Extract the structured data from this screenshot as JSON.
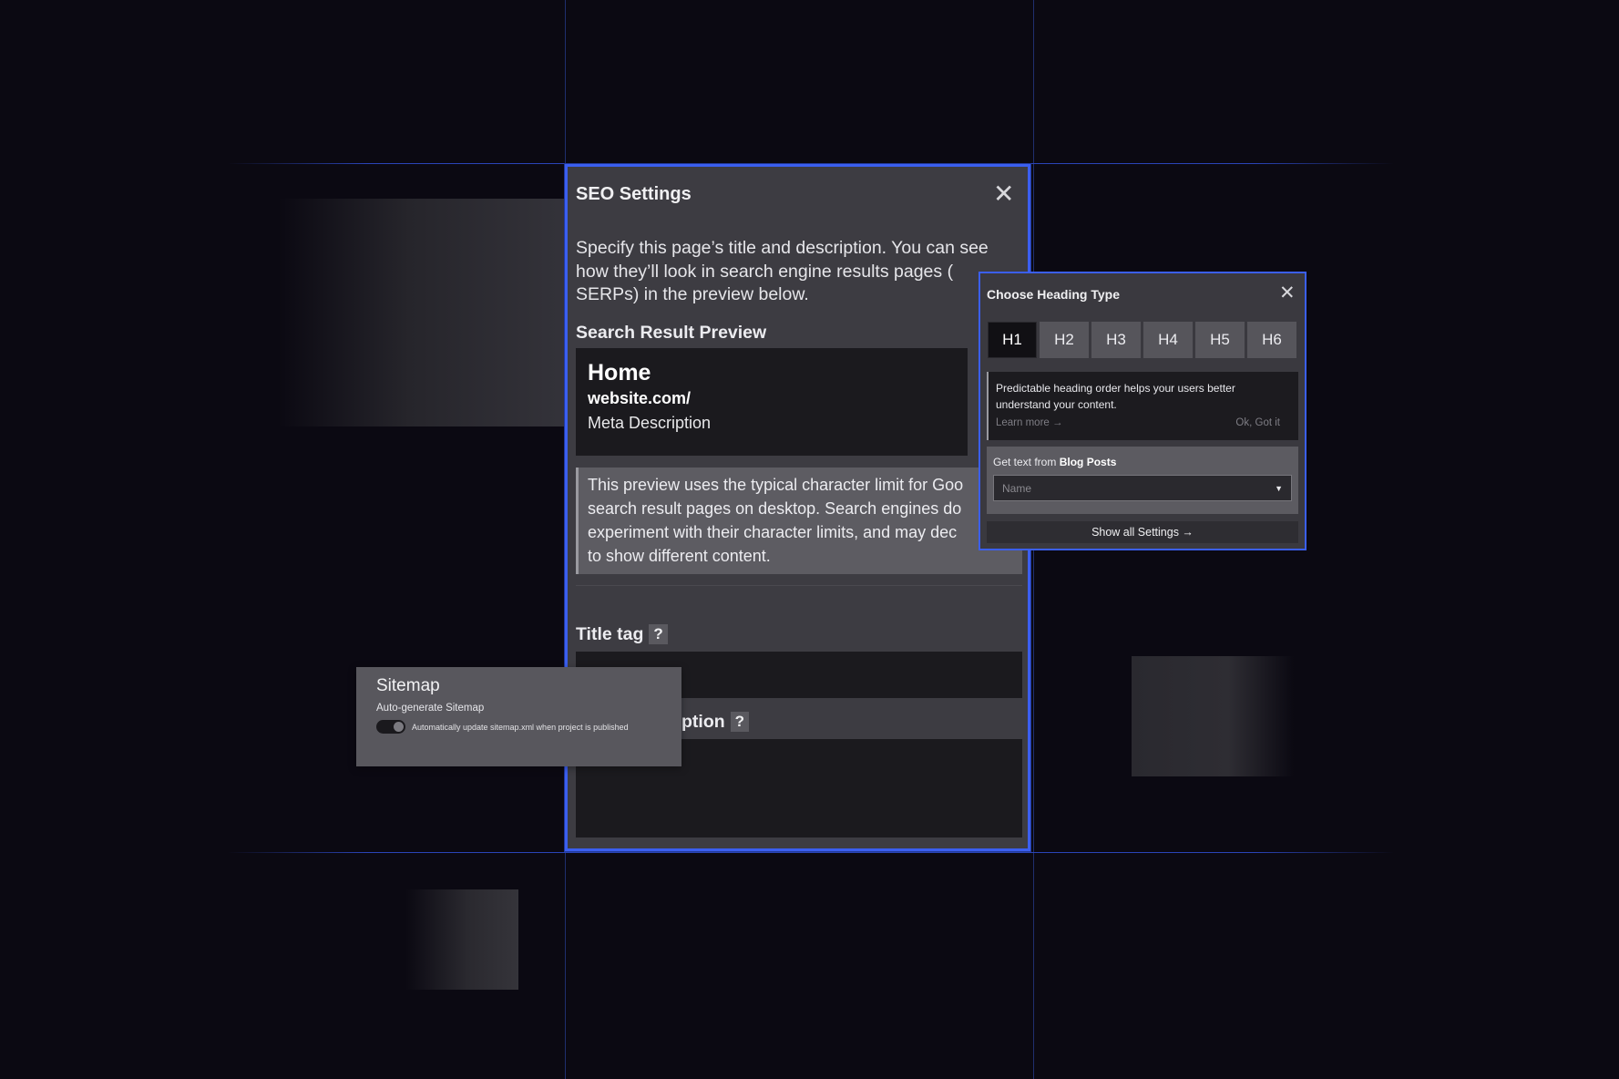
{
  "seo": {
    "title": "SEO Settings",
    "close_label": "✕",
    "intro": "Specify this page’s title and description. You can see how they’ll look in search engine results pages ( SERPs) in the preview below.",
    "search_preview_heading": "Search Result Preview",
    "preview": {
      "title": "Home",
      "url": "website.com/",
      "description": "Meta Description"
    },
    "note_lines": [
      "This preview uses the typical character limit for Goo",
      "search result pages on desktop. Search engines do",
      "experiment with their character limits, and may dec",
      "to show different content."
    ],
    "title_tag_label": "Title tag",
    "help_label": "?",
    "meta_description_label_visible": "ption"
  },
  "sitemap": {
    "title": "Sitemap",
    "subtitle": "Auto-generate Sitemap",
    "toggle_on": true,
    "toggle_description": "Automatically update sitemap.xml when project is published"
  },
  "heading_popover": {
    "title": "Choose Heading Type",
    "close_label": "✕",
    "tabs": [
      "H1",
      "H2",
      "H3",
      "H4",
      "H5",
      "H6"
    ],
    "active_tab": "H1",
    "note": "Predictable heading order helps your users better understand your content.",
    "learn_more": "Learn more →",
    "dismiss": "Ok, Got it",
    "get_text_prefix": "Get text from",
    "get_text_source": "Blog Posts",
    "select_placeholder": "Name",
    "select_caret": "▼",
    "show_all": "Show all Settings →"
  },
  "colors": {
    "accent": "#3b5ff0",
    "background": "#0b0912",
    "panel": "#3d3c42"
  }
}
